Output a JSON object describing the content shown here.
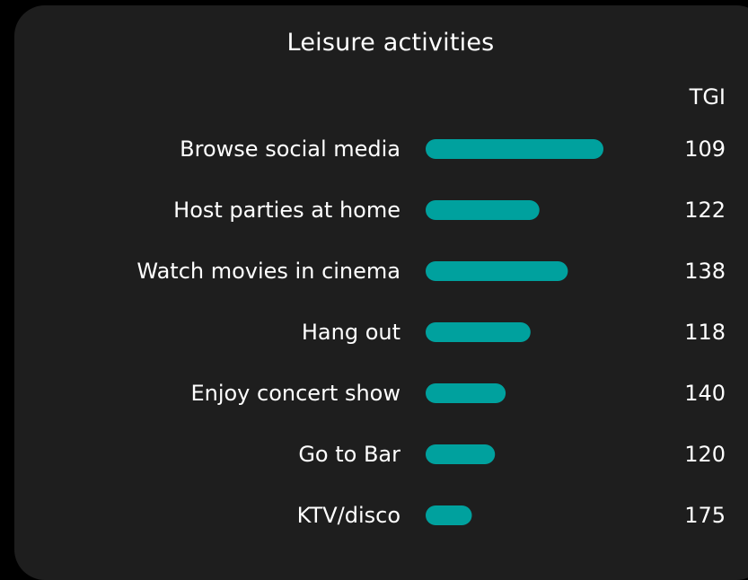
{
  "chart_data": {
    "type": "bar",
    "orientation": "horizontal",
    "title": "Leisure activities",
    "value_column_header": "TGI",
    "categories": [
      "Browse social media",
      "Host parties at home",
      "Watch movies in cinema",
      "Hang out",
      "Enjoy concert show",
      "Go to Bar",
      "KTV/disco"
    ],
    "series": [
      {
        "values": [
          100,
          64,
          80,
          59,
          45,
          39,
          26
        ],
        "color": "#00a19e"
      }
    ],
    "tgi": [
      "109",
      "122",
      "138",
      "118",
      "140",
      "120",
      "175"
    ],
    "xlim": [
      0,
      100
    ],
    "grid": false,
    "legend": "none"
  },
  "colors": {
    "background": "#000000",
    "card": "#1e1e1e",
    "bar": "#00a19e",
    "text": "#ffffff"
  }
}
